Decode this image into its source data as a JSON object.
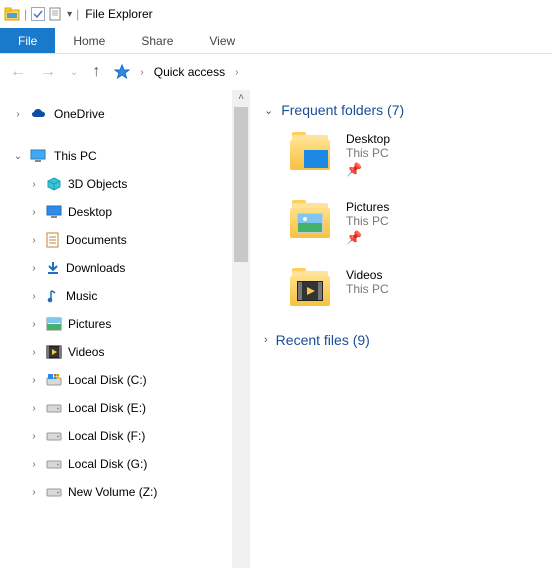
{
  "titlebar": {
    "sep1": "|",
    "sep2": "|",
    "title": "File Explorer"
  },
  "ribbon": {
    "file": "File",
    "home": "Home",
    "share": "Share",
    "view": "View"
  },
  "address": {
    "location": "Quick access"
  },
  "tree": {
    "onedrive": "OneDrive",
    "thispc": "This PC",
    "children": [
      "3D Objects",
      "Desktop",
      "Documents",
      "Downloads",
      "Music",
      "Pictures",
      "Videos",
      "Local Disk (C:)",
      "Local Disk (E:)",
      "Local Disk (F:)",
      "Local Disk (G:)",
      "New Volume (Z:)"
    ]
  },
  "main": {
    "frequent": {
      "label": "Frequent folders (7)"
    },
    "recent": {
      "label": "Recent files (9)"
    },
    "items": [
      {
        "name": "Desktop",
        "loc": "This PC",
        "pin": true
      },
      {
        "name": "Pictures",
        "loc": "This PC",
        "pin": true
      },
      {
        "name": "Videos",
        "loc": "This PC",
        "pin": false
      }
    ]
  }
}
